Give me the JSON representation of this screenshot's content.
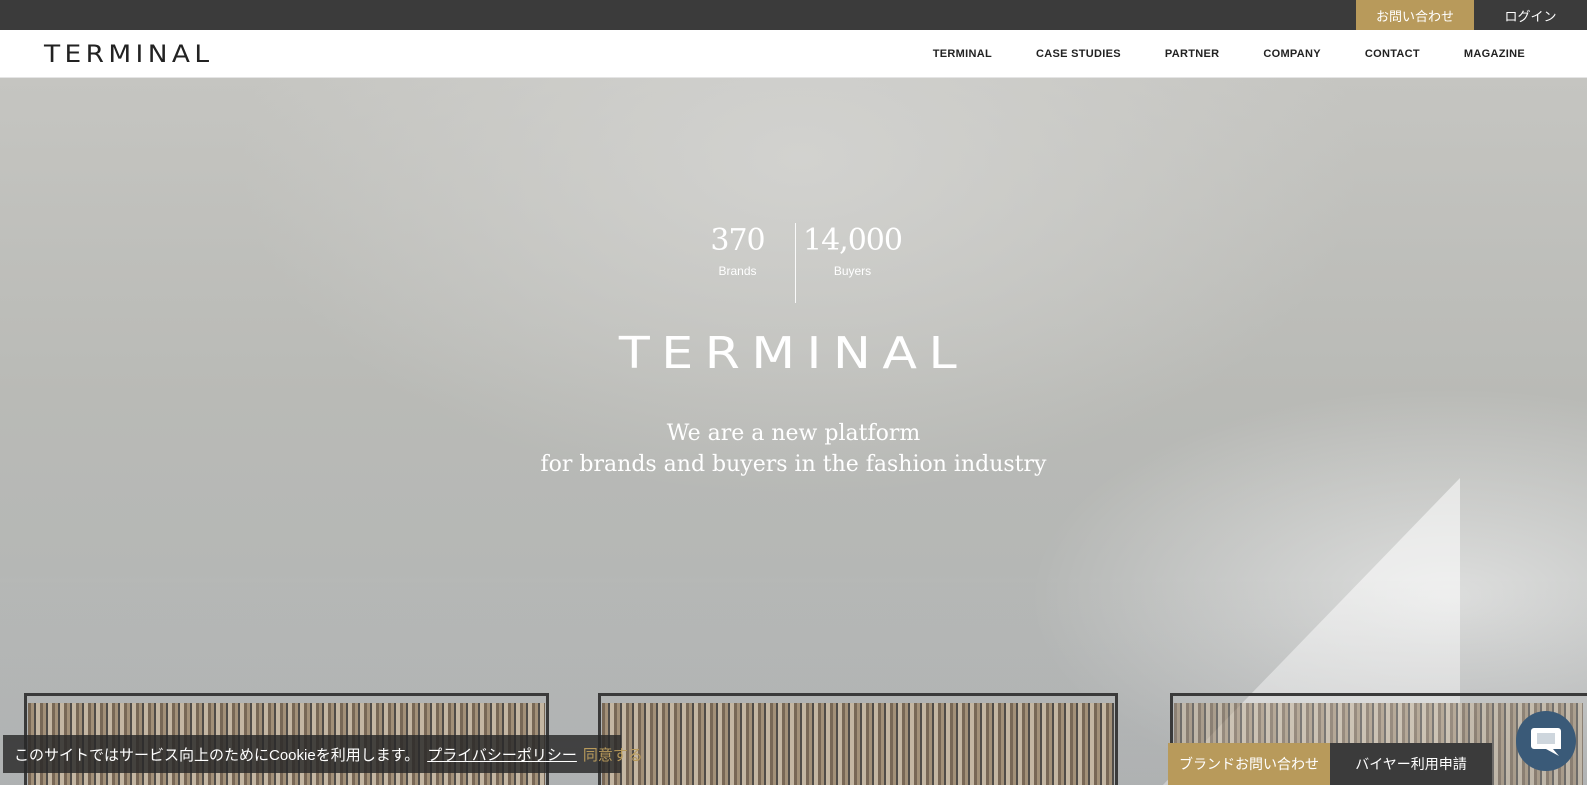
{
  "topbar": {
    "contact_label": "お問い合わせ",
    "login_label": "ログイン"
  },
  "header": {
    "logo_text": "TERMINAL",
    "nav": [
      {
        "label": "TERMINAL"
      },
      {
        "label": "CASE STUDIES"
      },
      {
        "label": "PARTNER"
      },
      {
        "label": "COMPANY"
      },
      {
        "label": "CONTACT"
      },
      {
        "label": "MAGAZINE"
      }
    ]
  },
  "hero": {
    "stats": [
      {
        "value": "370",
        "label": "Brands"
      },
      {
        "value": "14,000",
        "label": "Buyers"
      }
    ],
    "logo_text": "TERMINAL",
    "tagline_line1": "We are a new platform",
    "tagline_line2": "for brands and buyers in the fashion industry"
  },
  "cookie": {
    "message": "このサイトではサービス向上のためにCookieを利用します。",
    "policy_link": "プライバシーポリシー",
    "agree_label": "同意する"
  },
  "cta": {
    "brand_label": "ブランドお問い合わせ",
    "buyer_label": "バイヤー利用申請"
  },
  "chat": {
    "icon": "chat-bubble-icon"
  },
  "colors": {
    "accent": "#b89a5b",
    "dark": "#3b3b3b",
    "chat": "#3a5a78"
  }
}
